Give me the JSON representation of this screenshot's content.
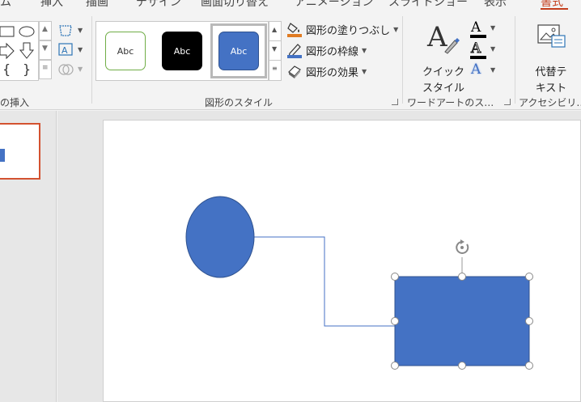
{
  "tabs": [
    {
      "label": "ム",
      "active": false
    },
    {
      "label": "挿入",
      "active": false
    },
    {
      "label": "描画",
      "active": false
    },
    {
      "label": "デザイン",
      "active": false
    },
    {
      "label": "画面切り替え",
      "active": false
    },
    {
      "label": "アニメーション",
      "active": false
    },
    {
      "label": "スライドショー",
      "active": false
    },
    {
      "label": "表示",
      "active": false
    },
    {
      "label": "書式",
      "active": true
    }
  ],
  "ribbon": {
    "insert_shapes_group": {
      "label": "の挿入"
    },
    "shape_styles_group": {
      "label": "図形のスタイル",
      "gallery": [
        {
          "text": "Abc",
          "style": "white-outline-green"
        },
        {
          "text": "Abc",
          "style": "black-fill"
        },
        {
          "text": "Abc",
          "style": "blue-fill",
          "selected": true
        }
      ],
      "fill_label": "図形の塗りつぶし",
      "outline_label": "図形の枠線",
      "effects_label": "図形の効果"
    },
    "wordart_group": {
      "label": "ワードアートのス…",
      "quick_style_line1": "クイック",
      "quick_style_line2": "スタイル",
      "text_fill_letter": "A",
      "text_outline_letter": "A",
      "text_effects_letter": "A"
    },
    "accessibility_group": {
      "label": "アクセシビリ…",
      "alt_text_line1": "代替テ",
      "alt_text_line2": "キスト"
    }
  },
  "colors": {
    "accent": "#c43e1c",
    "shape_fill": "#4472c4",
    "shape_stroke": "#2f528f",
    "fill_color_bar": "#e07b22",
    "outline_color_bar": "#4472c4"
  }
}
